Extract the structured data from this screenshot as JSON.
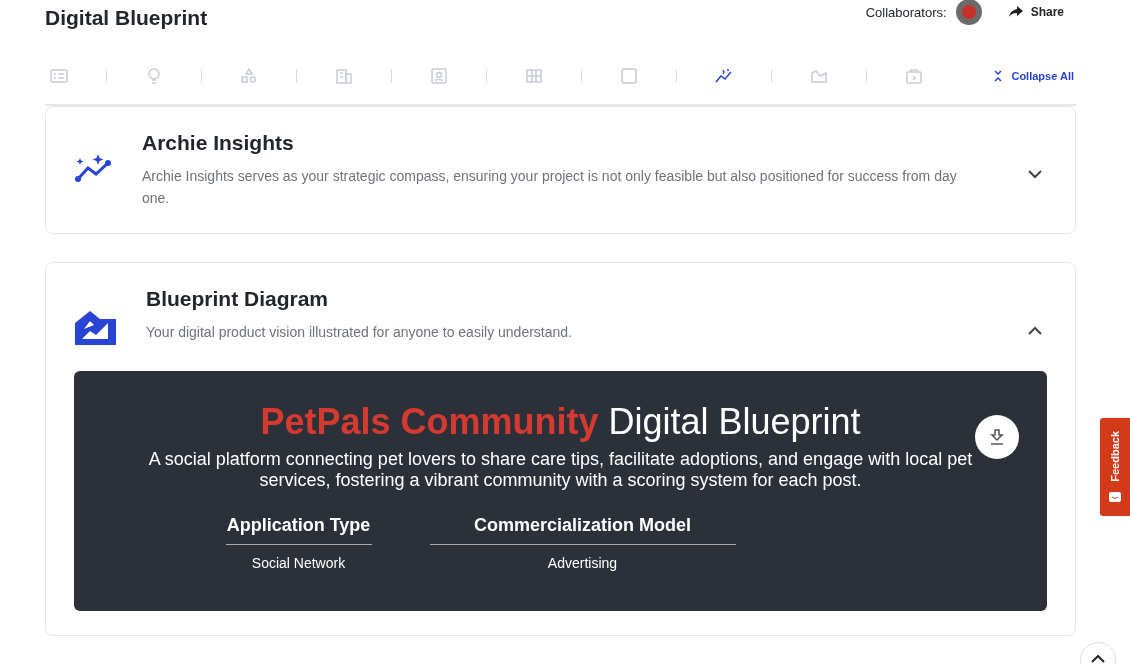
{
  "header": {
    "title": "Digital Blueprint",
    "collaborators_label": "Collaborators:",
    "share": "Share"
  },
  "toolbar": {
    "items": [
      {
        "kind": "list",
        "selected": false
      },
      {
        "kind": "bulb",
        "selected": false
      },
      {
        "kind": "shapes",
        "selected": false
      },
      {
        "kind": "building",
        "selected": false
      },
      {
        "kind": "profile",
        "selected": false
      },
      {
        "kind": "grid",
        "selected": false
      },
      {
        "kind": "dice",
        "selected": false
      },
      {
        "kind": "insights",
        "selected": true
      },
      {
        "kind": "diagram",
        "selected": false
      },
      {
        "kind": "case",
        "selected": false
      }
    ],
    "collapse_all": "Collapse All"
  },
  "sections": [
    {
      "kind": "insights",
      "title": "Archie Insights",
      "description": "Archie Insights serves as your strategic compass, ensuring your project is not only feasible but also positioned for success from day one.",
      "expanded": false
    },
    {
      "kind": "diagram",
      "title": "Blueprint Diagram",
      "description": "Your digital product vision illustrated for anyone to easily understand.",
      "expanded": true,
      "panel": {
        "title_highlight": "PetPals Community",
        "title_rest": "Digital Blueprint",
        "description": "A social platform connecting pet lovers to share care tips, facilitate adoptions, and engage with local pet services, fostering a vibrant community with a scoring system for each post.",
        "facts": [
          {
            "label": "Application Type",
            "value": "Social Network"
          },
          {
            "label": "Commercialization Model",
            "value": "Advertising"
          }
        ]
      }
    }
  ],
  "feedback": "Feedback"
}
